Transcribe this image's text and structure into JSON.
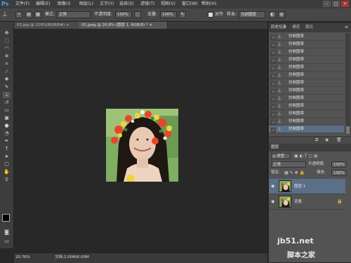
{
  "app": {
    "logo": "Ps"
  },
  "menu": [
    "文件(F)",
    "编辑(E)",
    "图像(I)",
    "图层(L)",
    "文字(Y)",
    "选择(S)",
    "滤镜(T)",
    "视图(V)",
    "窗口(W)",
    "帮助(H)"
  ],
  "window_controls": [
    "–",
    "□",
    "×"
  ],
  "options": {
    "mode_label": "模式:",
    "mode_value": "正常",
    "opacity_label": "不透明度:",
    "opacity_value": "100%",
    "flow_label": "流量:",
    "flow_value": "100%",
    "align_label": "对齐",
    "sample_label": "样本:",
    "sample_value": "当前图层"
  },
  "tabs": [
    {
      "label": "02.jpg @ 119%(RGB/8#) ×",
      "active": false
    },
    {
      "label": "02.jpeg @ 20.8% (图层 1, RGB/8) * ×",
      "active": true
    }
  ],
  "status": {
    "zoom": "20.76%",
    "doc": "文档:2.00M/6.00M"
  },
  "history": {
    "tabs": [
      "历史记录",
      "通道",
      "路径"
    ],
    "items": [
      "仿制图章",
      "仿制图章",
      "仿制图章",
      "仿制图章",
      "仿制图章",
      "仿制图章",
      "仿制图章",
      "仿制图章",
      "仿制图章",
      "仿制图章",
      "仿制图章",
      "仿制图章",
      "仿制图章"
    ],
    "selected_index": 12
  },
  "layers": {
    "tab": "图层",
    "kind_value": "p 类型",
    "blend_value": "正常",
    "opacity_label": "不透明度:",
    "opacity_value": "100%",
    "lock_label": "锁定:",
    "fill_label": "填充:",
    "fill_value": "100%",
    "items": [
      {
        "name": "图层 1",
        "selected": true
      },
      {
        "name": "背景",
        "selected": false
      }
    ]
  },
  "watermark": {
    "line1": "jb51.net",
    "line2": "脚本之家"
  },
  "colors": {
    "selection": "#5b6e86",
    "panel": "#535353",
    "canvas_bg": "#282828"
  }
}
